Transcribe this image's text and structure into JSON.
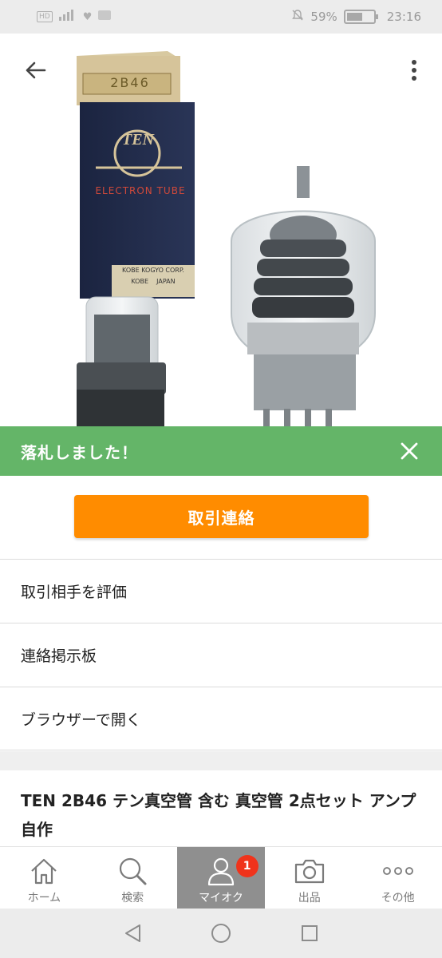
{
  "status_bar": {
    "battery": "59%",
    "time": "23:16",
    "battery_fraction": 0.59
  },
  "hero": {
    "box_brand": "TEN",
    "box_model": "2B46",
    "box_subtitle": "ELECTRON TUBE",
    "box_maker": "KOBE KOGYO CORP.",
    "box_origin": "KOBE    JAPAN"
  },
  "toast": {
    "text": "落札しました！"
  },
  "primary_action": {
    "label": "取引連絡"
  },
  "menu": {
    "items": [
      {
        "label": "取引相手を評価"
      },
      {
        "label": "連絡掲示板"
      },
      {
        "label": "ブラウザーで開く"
      }
    ]
  },
  "item": {
    "title": "TEN 2B46 テン真空管 含む 真空管 2点セット アンプ 自作"
  },
  "bottom_nav": {
    "items": [
      {
        "label": "ホーム",
        "icon": "home-icon"
      },
      {
        "label": "検索",
        "icon": "search-icon"
      },
      {
        "label": "マイオク",
        "icon": "person-icon",
        "badge": "1",
        "active": true
      },
      {
        "label": "出品",
        "icon": "camera-icon"
      },
      {
        "label": "その他",
        "icon": "more-dots-icon"
      }
    ]
  },
  "colors": {
    "toast": "#64b568",
    "primary": "#ff8c00",
    "badge": "#f0331b",
    "nav_active": "#8f8f8f"
  }
}
